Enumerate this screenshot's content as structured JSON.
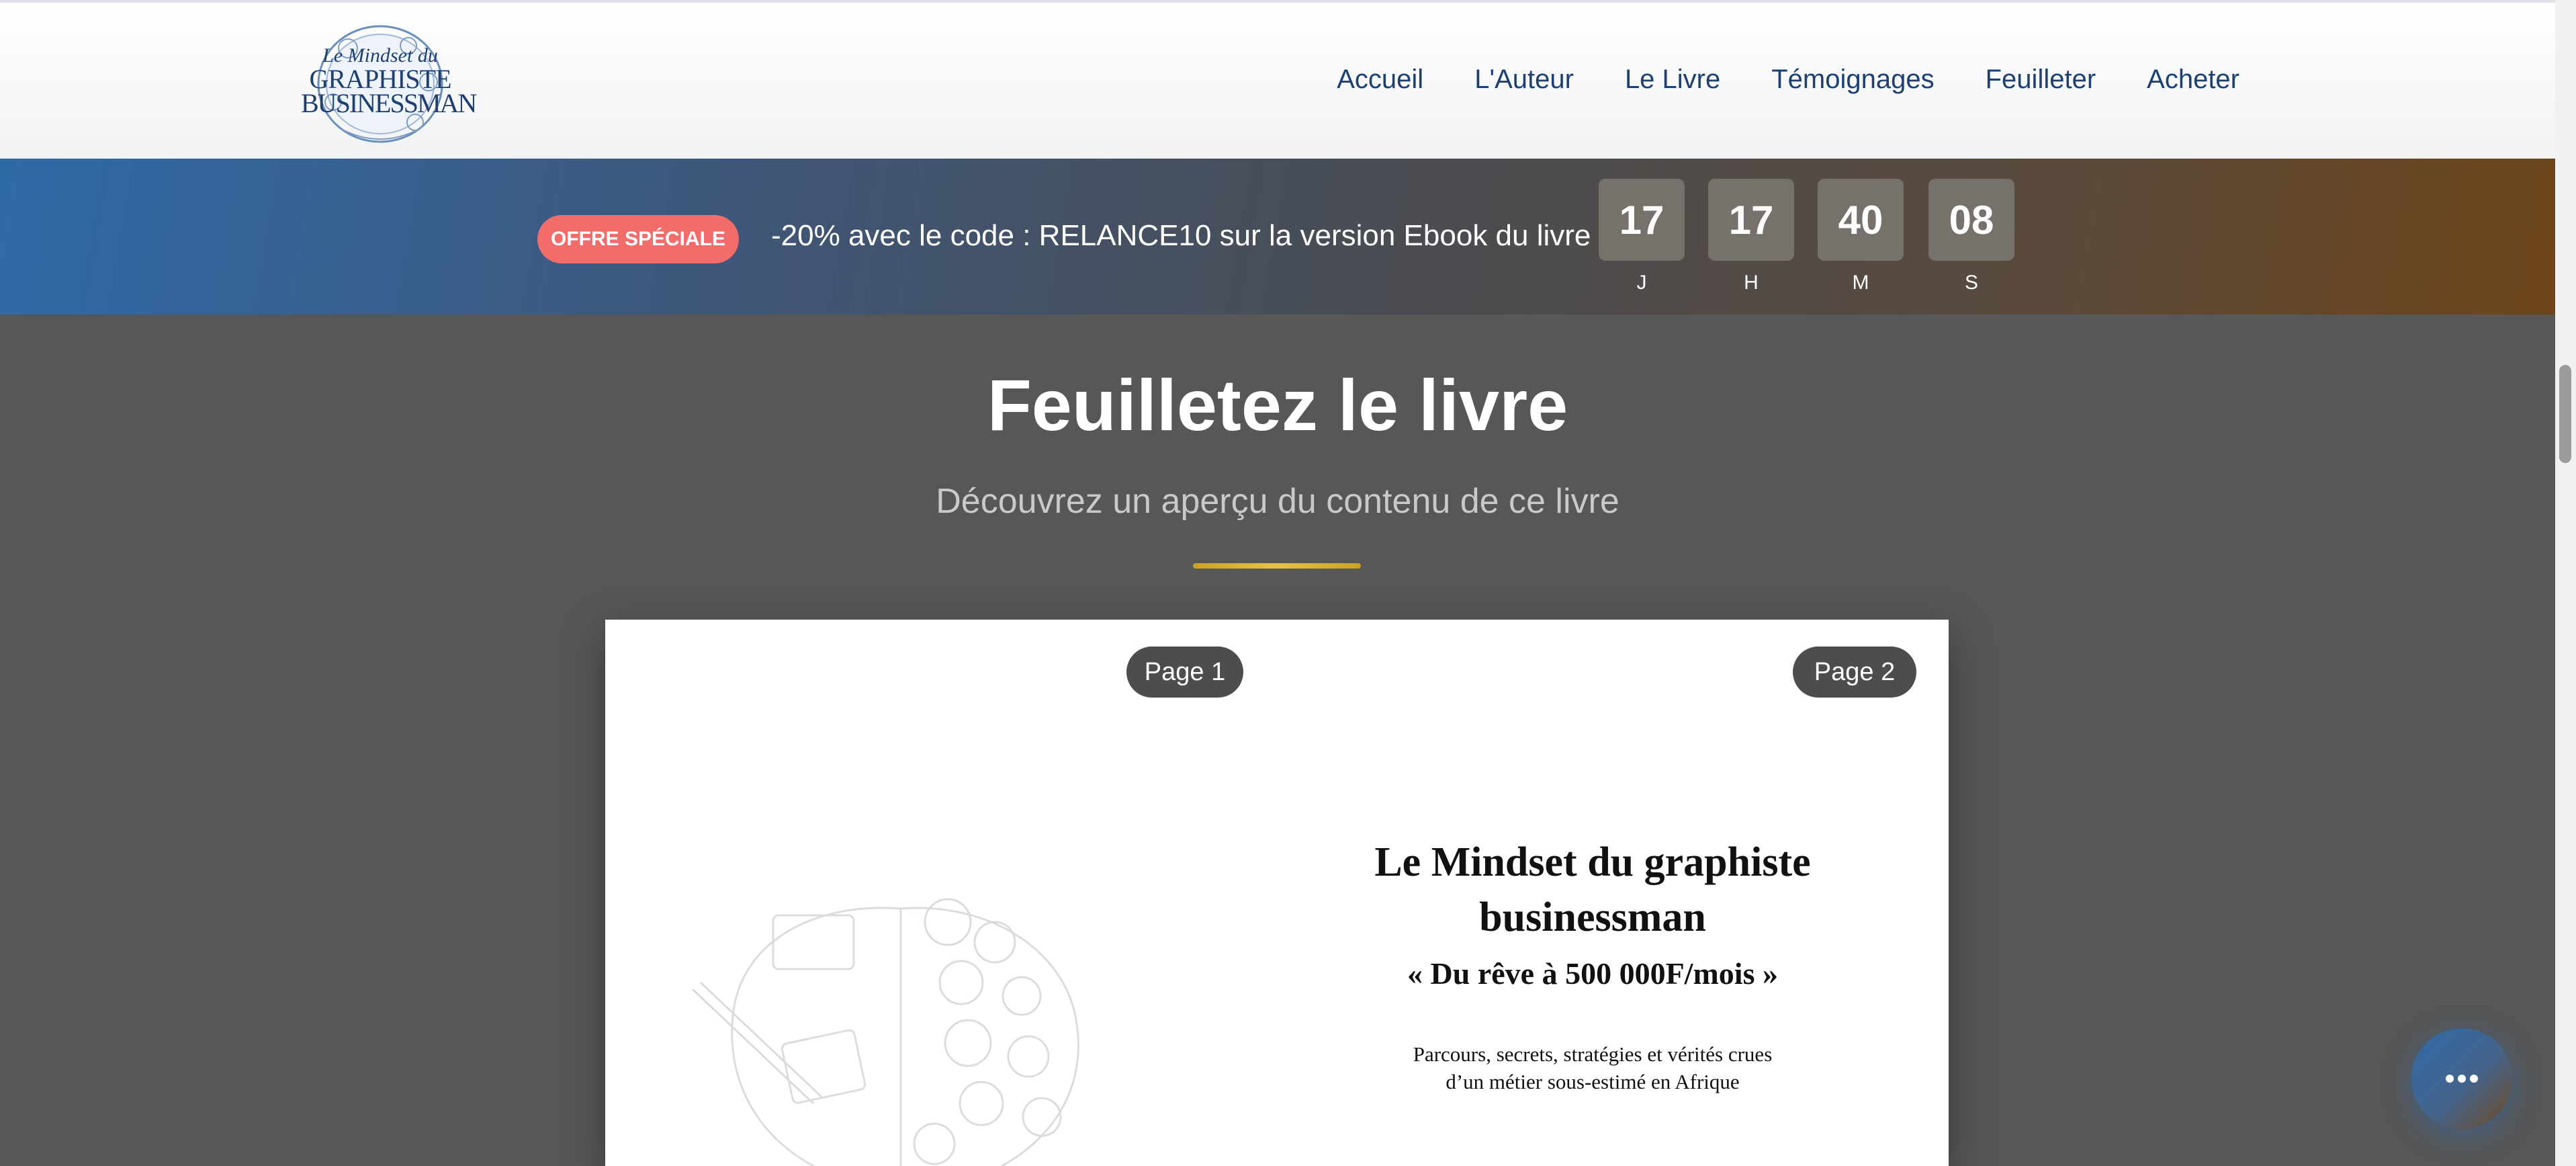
{
  "header": {
    "logo": {
      "line1": "Le Mindset du",
      "line2": "GRAPHISTE",
      "line3": "BUSINESSMAN"
    },
    "nav": [
      "Accueil",
      "L'Auteur",
      "Le Livre",
      "Témoignages",
      "Feuilleter",
      "Acheter"
    ]
  },
  "promo": {
    "badge": "OFFRE SPÉCIALE",
    "text": "-20% avec le code : RELANCE10 sur la version Ebook du livre",
    "countdown": [
      {
        "value": "17",
        "label": "J"
      },
      {
        "value": "17",
        "label": "H"
      },
      {
        "value": "40",
        "label": "M"
      },
      {
        "value": "08",
        "label": "S"
      }
    ]
  },
  "section": {
    "title": "Feuilletez le livre",
    "subtitle": "Découvrez un aperçu du contenu de ce livre"
  },
  "book": {
    "page_left_label": "Page 1",
    "page_right_label": "Page 2",
    "title_line1": "Le Mindset du graphiste",
    "title_line2": "businessman",
    "subtitle": "« Du rêve à 500 000F/mois »",
    "desc_line1": "Parcours, secrets, stratégies et vérités crues",
    "desc_line2": "d’un métier sous-estimé en Afrique"
  },
  "colors": {
    "nav_text": "#1d3f72",
    "badge": "#f26c6c",
    "accent_gold": "#d4ad2f",
    "page_bg": "#575757"
  },
  "icons": {
    "fab": "more-dots-icon"
  }
}
